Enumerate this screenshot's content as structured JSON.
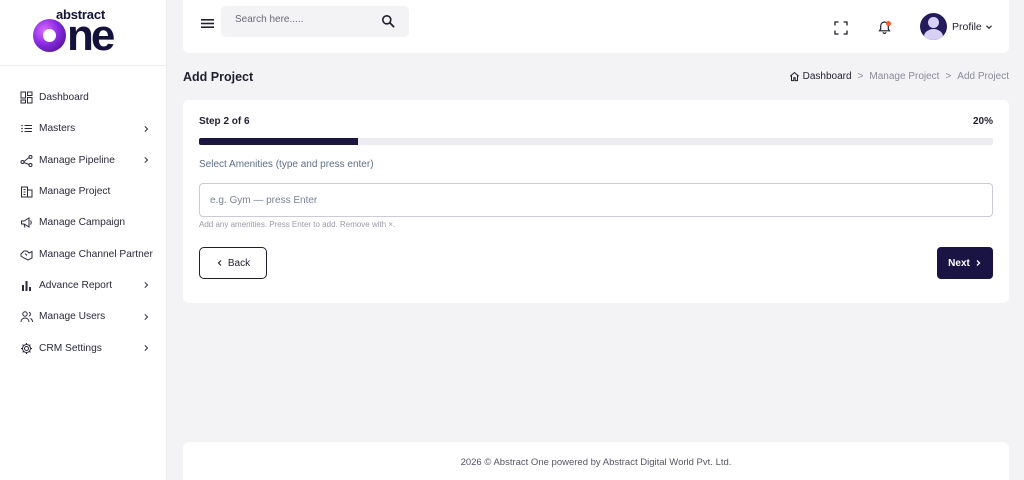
{
  "brand": {
    "top": "abstract",
    "main_rest": "ne"
  },
  "sidebar": {
    "items": [
      {
        "label": "Dashboard",
        "icon": "dashboard-icon",
        "has_children": false
      },
      {
        "label": "Masters",
        "icon": "list-icon",
        "has_children": true
      },
      {
        "label": "Manage Pipeline",
        "icon": "pipeline-icon",
        "has_children": true
      },
      {
        "label": "Manage Project",
        "icon": "building-icon",
        "has_children": false
      },
      {
        "label": "Manage Campaign",
        "icon": "megaphone-icon",
        "has_children": false
      },
      {
        "label": "Manage Channel Partner",
        "icon": "handshake-icon",
        "has_children": false
      },
      {
        "label": "Advance Report",
        "icon": "bar-chart-icon",
        "has_children": true
      },
      {
        "label": "Manage Users",
        "icon": "users-icon",
        "has_children": true
      },
      {
        "label": "CRM Settings",
        "icon": "gear-icon",
        "has_children": true
      }
    ]
  },
  "topbar": {
    "search_placeholder": "Search here.....",
    "profile_label": "Profile",
    "notification_dot_color": "#ff5a2a"
  },
  "page": {
    "title": "Add Project",
    "breadcrumb": [
      "Dashboard",
      "Manage Project",
      "Add Project"
    ],
    "breadcrumb_sep": ">"
  },
  "form": {
    "step_label": "Step 2 of 6",
    "progress_label": "20%",
    "progress_fraction": 0.2,
    "amenities_label": "Select Amenities (type and press enter)",
    "amenities_placeholder": "e.g. Gym — press Enter",
    "amenities_value": "",
    "hint": "Add any amenities. Press Enter to add. Remove with ×.",
    "back_label": "Back",
    "next_label": "Next"
  },
  "footer": {
    "text": "2026 © Abstract One powered by Abstract Digital World Pvt. Ltd."
  },
  "colors": {
    "primary": "#1a1445",
    "background": "#f3f3f6"
  }
}
